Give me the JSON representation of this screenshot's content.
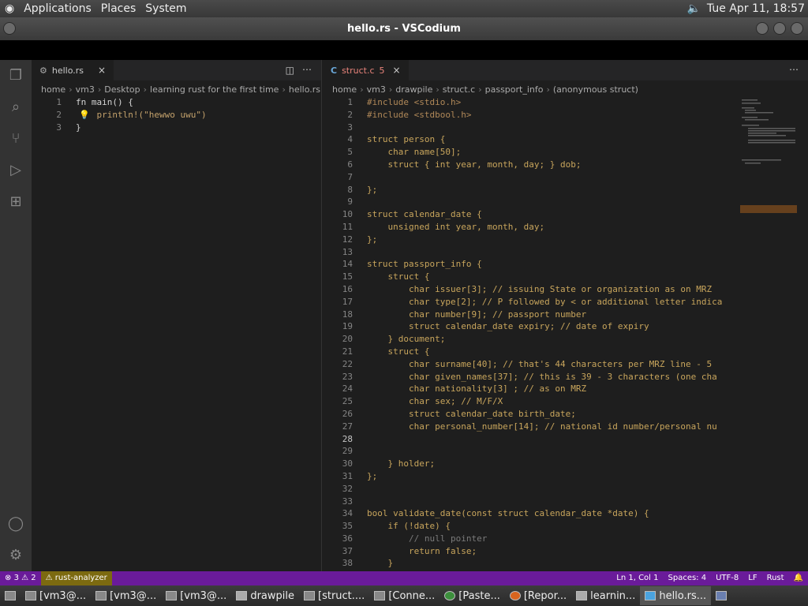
{
  "topbar": {
    "menus": [
      "Applications",
      "Places",
      "System"
    ],
    "clock": "Tue Apr 11, 18:57"
  },
  "window": {
    "title": "hello.rs - VSCodium"
  },
  "left_editor": {
    "tab": {
      "label": "hello.rs"
    },
    "breadcrumb": [
      "home",
      "vm3",
      "Desktop",
      "learning rust for the first time",
      "hello.rs"
    ],
    "lines": [
      {
        "n": "1",
        "t": "fn main() {"
      },
      {
        "n": "2",
        "t": "    println!(\"hewwo uwu\")"
      },
      {
        "n": "3",
        "t": "}"
      }
    ]
  },
  "right_editor": {
    "tab": {
      "label": "struct.c",
      "badge": "5"
    },
    "breadcrumb": [
      "home",
      "vm3",
      "drawpile",
      "struct.c",
      "passport_info",
      "(anonymous struct)"
    ],
    "lines": [
      {
        "n": "1",
        "t": "#include <stdio.h>"
      },
      {
        "n": "2",
        "t": "#include <stdbool.h>"
      },
      {
        "n": "3",
        "t": ""
      },
      {
        "n": "4",
        "t": "struct person {"
      },
      {
        "n": "5",
        "t": "    char name[50];"
      },
      {
        "n": "6",
        "t": "    struct { int year, month, day; } dob;"
      },
      {
        "n": "7",
        "t": ""
      },
      {
        "n": "8",
        "t": "};"
      },
      {
        "n": "9",
        "t": ""
      },
      {
        "n": "10",
        "t": "struct calendar_date {"
      },
      {
        "n": "11",
        "t": "    unsigned int year, month, day;"
      },
      {
        "n": "12",
        "t": "};"
      },
      {
        "n": "13",
        "t": ""
      },
      {
        "n": "14",
        "t": "struct passport_info {"
      },
      {
        "n": "15",
        "t": "    struct {"
      },
      {
        "n": "16",
        "t": "        char issuer[3]; // issuing State or organization as on MRZ"
      },
      {
        "n": "17",
        "t": "        char type[2]; // P followed by < or additional letter indica"
      },
      {
        "n": "18",
        "t": "        char number[9]; // passport number"
      },
      {
        "n": "19",
        "t": "        struct calendar_date expiry; // date of expiry"
      },
      {
        "n": "20",
        "t": "    } document;"
      },
      {
        "n": "21",
        "t": "    struct {"
      },
      {
        "n": "22",
        "t": "        char surname[40]; // that's 44 characters per MRZ line - 5"
      },
      {
        "n": "23",
        "t": "        char given_names[37]; // this is 39 - 3 characters (one cha"
      },
      {
        "n": "24",
        "t": "        char nationality[3] ; // as on MRZ"
      },
      {
        "n": "25",
        "t": "        char sex; // M/F/X"
      },
      {
        "n": "26",
        "t": "        struct calendar_date birth_date;"
      },
      {
        "n": "27",
        "t": "        char personal_number[14]; // national id number/personal nu"
      },
      {
        "n": "28",
        "t": ""
      },
      {
        "n": "29",
        "t": ""
      },
      {
        "n": "30",
        "t": "    } holder;"
      },
      {
        "n": "31",
        "t": "};"
      },
      {
        "n": "32",
        "t": ""
      },
      {
        "n": "33",
        "t": ""
      },
      {
        "n": "34",
        "t": "bool validate_date(const struct calendar_date *date) {"
      },
      {
        "n": "35",
        "t": "    if (!date) {"
      },
      {
        "n": "36",
        "t": "        // null pointer"
      },
      {
        "n": "37",
        "t": "        return false;"
      },
      {
        "n": "38",
        "t": "    }"
      }
    ]
  },
  "statusbar": {
    "errors": "3",
    "warnings": "2",
    "extension": "rust-analyzer",
    "position": "Ln 1, Col 1",
    "spaces": "Spaces: 4",
    "encoding": "UTF-8",
    "eol": "LF",
    "language": "Rust"
  },
  "taskbar": {
    "items": [
      "[vm3@...",
      "[vm3@...",
      "[vm3@...",
      "drawpile",
      "[struct....",
      "[Conne...",
      "[Paste...",
      "[Repor...",
      "learnin...",
      "hello.rs..."
    ]
  },
  "colors": {
    "status": "#6a1b9a",
    "accent": "#d9a441"
  }
}
